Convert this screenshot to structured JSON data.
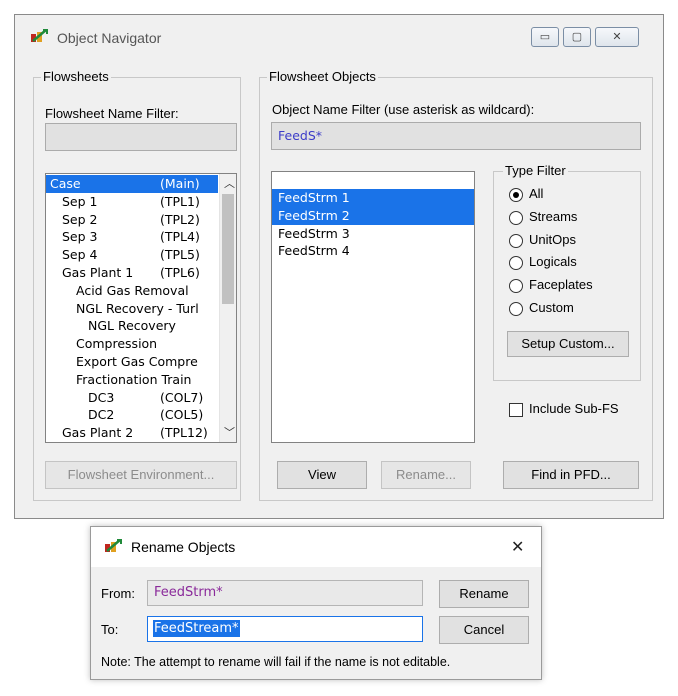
{
  "navigator": {
    "title": "Object Navigator",
    "window_controls": {
      "minimize": "▭",
      "maximize": "▢",
      "close": "✕"
    },
    "flowsheets_group": {
      "label": "Flowsheets",
      "name_filter_label": "Flowsheet Name Filter:",
      "name_filter_value": "",
      "items": [
        {
          "name": "Case",
          "tag": "(Main)",
          "indent": 0,
          "selected": true
        },
        {
          "name": "Sep 1",
          "tag": "(TPL1)",
          "indent": 1,
          "selected": false
        },
        {
          "name": "Sep 2",
          "tag": "(TPL2)",
          "indent": 1,
          "selected": false
        },
        {
          "name": "Sep 3",
          "tag": "(TPL4)",
          "indent": 1,
          "selected": false
        },
        {
          "name": "Sep 4",
          "tag": "(TPL5)",
          "indent": 1,
          "selected": false
        },
        {
          "name": "Gas Plant 1",
          "tag": "(TPL6)",
          "indent": 1,
          "selected": false
        },
        {
          "name": "Acid Gas Removal",
          "tag": "",
          "indent": 2,
          "selected": false
        },
        {
          "name": "NGL Recovery - Turl",
          "tag": "",
          "indent": 2,
          "selected": false
        },
        {
          "name": "NGL Recovery",
          "tag": "",
          "indent": 3,
          "selected": false
        },
        {
          "name": "Compression",
          "tag": "",
          "indent": 2,
          "selected": false
        },
        {
          "name": "Export Gas Compre",
          "tag": "",
          "indent": 2,
          "selected": false
        },
        {
          "name": "Fractionation Train",
          "tag": "",
          "indent": 2,
          "selected": false
        },
        {
          "name": "DC3",
          "tag": "(COL7)",
          "indent": 3,
          "selected": false
        },
        {
          "name": "DC2",
          "tag": "(COL5)",
          "indent": 3,
          "selected": false
        },
        {
          "name": "Gas Plant 2",
          "tag": "(TPL12)",
          "indent": 1,
          "selected": false
        }
      ],
      "environment_button": "Flowsheet Environment..."
    },
    "objects_group": {
      "label": "Flowsheet Objects",
      "name_filter_label": "Object Name Filter (use asterisk as wildcard):",
      "name_filter_value": "FeedS*",
      "items": [
        {
          "name": "FeedStrm 1",
          "selected": true
        },
        {
          "name": "FeedStrm 2",
          "selected": true
        },
        {
          "name": "FeedStrm 3",
          "selected": false
        },
        {
          "name": "FeedStrm 4",
          "selected": false
        }
      ],
      "type_filter": {
        "label": "Type Filter",
        "options": [
          "All",
          "Streams",
          "UnitOps",
          "Logicals",
          "Faceplates",
          "Custom"
        ],
        "selected": "All",
        "setup_custom_button": "Setup Custom..."
      },
      "include_subfs_label": "Include Sub-FS",
      "include_subfs_checked": false,
      "view_button": "View",
      "rename_button": "Rename...",
      "find_button": "Find in PFD..."
    }
  },
  "rename_dialog": {
    "title": "Rename Objects",
    "close_glyph": "✕",
    "from_label": "From:",
    "from_value": "FeedStrm*",
    "to_label": "To:",
    "to_value": "FeedStream*",
    "rename_button": "Rename",
    "cancel_button": "Cancel",
    "note": "Note: The attempt to rename will fail if the name is not editable."
  },
  "colors": {
    "selection": "#1a73e8",
    "filter_text": "#3c3cc8",
    "from_text": "#8a2a9a",
    "focus_border": "#1a73e8"
  }
}
